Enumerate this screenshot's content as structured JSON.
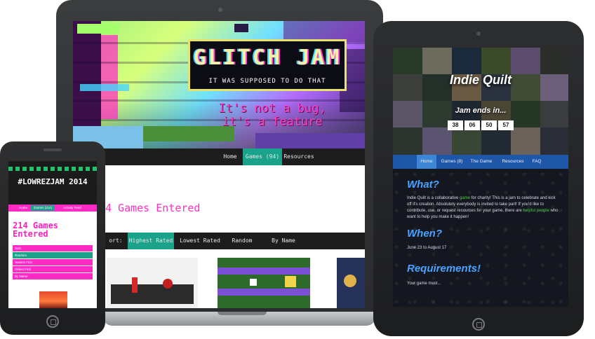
{
  "laptop": {
    "banner": {
      "title": "GLITCH JAM",
      "subtitle": "IT WAS SUPPOSED TO DO THAT",
      "tagline": "It's not a bug, it's a feature"
    },
    "nav": {
      "items": [
        "Home",
        "Games (94)",
        "Resources"
      ],
      "active": "Games (94)",
      "active_color": "#1aa38a"
    },
    "heading": "4 Games Entered",
    "sort": {
      "label": "ort:",
      "options": [
        "Highest Rated",
        "Lowest Rated",
        "Random",
        "By Name"
      ],
      "active": "Highest Rated"
    }
  },
  "tablet": {
    "banner": {
      "title": "Indie Quilt",
      "ends_label": "Jam ends in...",
      "countdown": [
        "38",
        "06",
        "50",
        "57"
      ]
    },
    "nav": {
      "items": [
        "Home",
        "Games (8)",
        "The Game",
        "Resources",
        "FAQ"
      ],
      "active": "Home"
    },
    "sections": {
      "what_heading": "What?",
      "what_text_1": "Indie Quilt is a collaborative",
      "what_link_1": "game",
      "what_text_2": "for charity! This is a jam to celebrate and kick off it's creation. Absolutely everybody is invited to take part! If you'd like to contribute, use, or request resources for your game, there are",
      "what_link_2": "helpful people",
      "what_text_3": "who want to help you make it happen!",
      "when_heading": "When?",
      "when_text": "June 23 to August 17",
      "req_heading": "Requirements!",
      "req_text": "Your game must..."
    }
  },
  "phone": {
    "title": "#LOWREZJAM 2014",
    "nav": {
      "items": [
        "Home",
        "Games (214)",
        "Activity Feed"
      ],
      "active": "Games (214)"
    },
    "heading": "214 Games Entered",
    "sort_options": [
      "Sort:",
      "Random",
      "Newest First",
      "Oldest First",
      "By Name"
    ]
  },
  "colors": {
    "glitch_pink": "#ff2fc4",
    "glitch_teal": "#1aa38a",
    "quilt_blue": "#1f57a8",
    "quilt_heading": "#4aa3ff",
    "lowrez_pink": "#ff29c6"
  }
}
